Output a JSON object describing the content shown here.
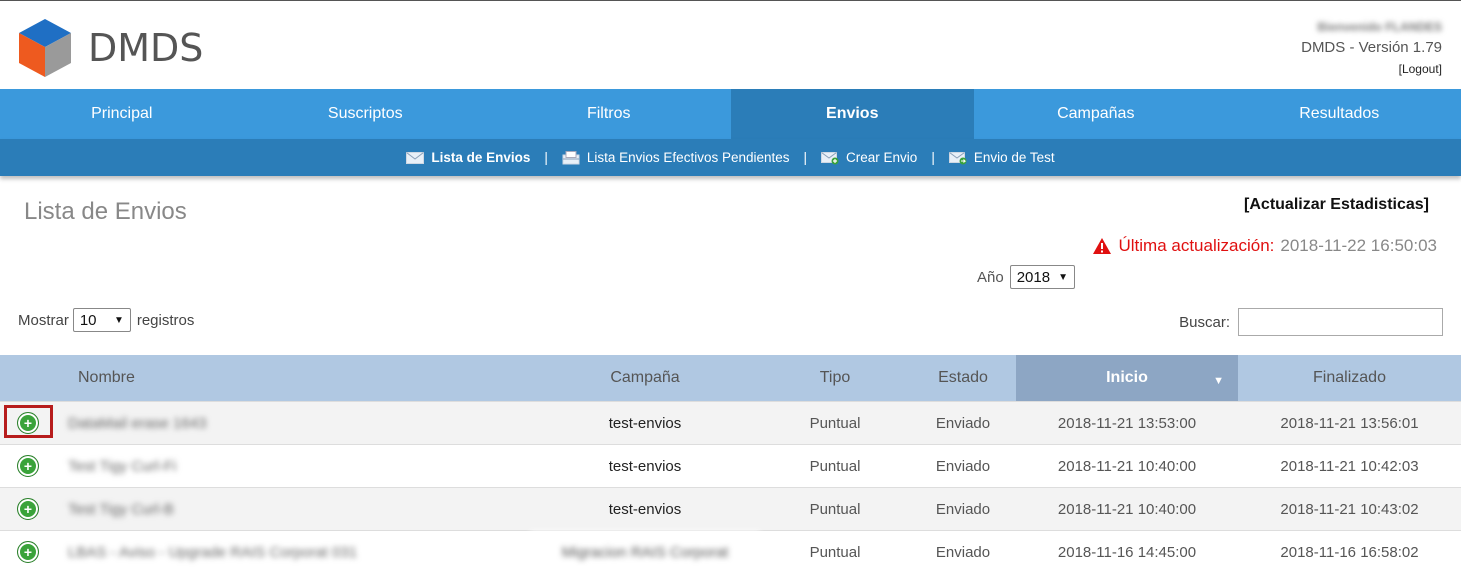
{
  "header": {
    "logo_text": "DMDS",
    "user_greeting": "Bienvenido FLANDES",
    "version": "DMDS - Versión 1.79",
    "logout": "[Logout]"
  },
  "main_nav": [
    {
      "label": "Principal"
    },
    {
      "label": "Suscriptos"
    },
    {
      "label": "Filtros"
    },
    {
      "label": "Envios",
      "active": true
    },
    {
      "label": "Campañas"
    },
    {
      "label": "Resultados"
    }
  ],
  "sub_nav": [
    {
      "label": "Lista de Envios",
      "icon": "envelope-icon",
      "active": true
    },
    {
      "label": "Lista Envios Efectivos Pendientes",
      "icon": "inbox-icon"
    },
    {
      "label": "Crear Envio",
      "icon": "envelope-add-icon"
    },
    {
      "label": "Envio de Test",
      "icon": "envelope-send-icon"
    }
  ],
  "page": {
    "title": "Lista de Envios",
    "refresh_link": "[Actualizar Estadisticas]",
    "last_update_label": "Última actualización:",
    "last_update_value": "2018-11-22 16:50:03",
    "year_label": "Año",
    "year_value": "2018",
    "show_label": "Mostrar",
    "show_value": "10",
    "records_label": "registros",
    "search_label": "Buscar:",
    "search_value": ""
  },
  "table": {
    "columns": [
      "Nombre",
      "Campaña",
      "Tipo",
      "Estado",
      "Inicio",
      "Finalizado"
    ],
    "sorted_column": "Inicio",
    "rows": [
      {
        "nombre": "DataMail erase 1643",
        "campana": "test-envios",
        "tipo": "Puntual",
        "estado": "Enviado",
        "inicio": "2018-11-21 13:53:00",
        "finalizado": "2018-11-21 13:56:01"
      },
      {
        "nombre": "Test Tigy Curl-Fi",
        "campana": "test-envios",
        "tipo": "Puntual",
        "estado": "Enviado",
        "inicio": "2018-11-21 10:40:00",
        "finalizado": "2018-11-21 10:42:03"
      },
      {
        "nombre": "Test Tigy Curl-B",
        "campana": "test-envios",
        "tipo": "Puntual",
        "estado": "Enviado",
        "inicio": "2018-11-21 10:40:00",
        "finalizado": "2018-11-21 10:43:02"
      },
      {
        "nombre": "LBAS - Aviso - Upgrade RAIS Corporat 031",
        "campana": "Migracion RAIS Corporat",
        "tipo": "Puntual",
        "estado": "Enviado",
        "inicio": "2018-11-16 14:45:00",
        "finalizado": "2018-11-16 16:58:02"
      }
    ]
  },
  "colors": {
    "nav_blue": "#3b99dc",
    "nav_active": "#2b7db8",
    "header_row": "#b0c8e2",
    "sorted_header": "#8da6c4",
    "warning_red": "#e01010",
    "expand_green": "#3aa33a"
  }
}
